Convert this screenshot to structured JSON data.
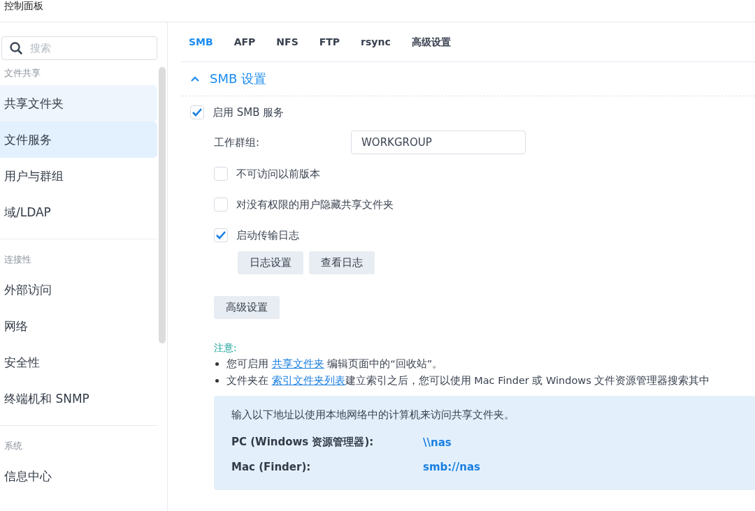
{
  "window": {
    "title": "控制面板"
  },
  "sidebar": {
    "search": {
      "placeholder": "搜索"
    },
    "sections": [
      {
        "title": "文件共享",
        "items": [
          {
            "label": "共享文件夹",
            "selected": false,
            "hovered": true
          },
          {
            "label": "文件服务",
            "selected": true,
            "hovered": false
          },
          {
            "label": "用户与群组",
            "selected": false,
            "hovered": false
          },
          {
            "label": "域/LDAP",
            "selected": false,
            "hovered": false
          }
        ]
      },
      {
        "title": "连接性",
        "items": [
          {
            "label": "外部访问",
            "selected": false,
            "hovered": false
          },
          {
            "label": "网络",
            "selected": false,
            "hovered": false
          },
          {
            "label": "安全性",
            "selected": false,
            "hovered": false
          },
          {
            "label": "终端机和 SNMP",
            "selected": false,
            "hovered": false
          }
        ]
      },
      {
        "title": "系统",
        "items": [
          {
            "label": "信息中心",
            "selected": false,
            "hovered": false
          }
        ]
      }
    ]
  },
  "tabs": [
    {
      "label": "SMB",
      "selected": true
    },
    {
      "label": "AFP",
      "selected": false
    },
    {
      "label": "NFS",
      "selected": false
    },
    {
      "label": "FTP",
      "selected": false
    },
    {
      "label": "rsync",
      "selected": false
    },
    {
      "label": "高级设置",
      "selected": false
    }
  ],
  "section": {
    "title": "SMB 设置",
    "expanded": true
  },
  "enable": {
    "label": "启用 SMB 服务",
    "checked": true
  },
  "workgroup": {
    "label": "工作群组:",
    "value": "WORKGROUP"
  },
  "options": [
    {
      "label": "不可访问以前版本",
      "checked": false
    },
    {
      "label": "对没有权限的用户隐藏共享文件夹",
      "checked": false
    },
    {
      "label": "启动传输日志",
      "checked": true
    }
  ],
  "log_buttons": [
    "日志设置",
    "查看日志"
  ],
  "advanced_button": "高级设置",
  "notes": {
    "title": "注意:",
    "items": [
      {
        "before": "您可启用 ",
        "link": "共享文件夹",
        "after": " 编辑页面中的“回收站”。"
      },
      {
        "before": "文件夹在 ",
        "link": "索引文件夹列表",
        "after": "建立索引之后，您可以使用 Mac Finder 或 Windows 文件资源管理器搜索其中"
      }
    ]
  },
  "access": {
    "intro": "输入以下地址以使用本地网络中的计算机来访问共享文件夹。",
    "rows": [
      {
        "label": "PC (Windows 资源管理器):",
        "value": "\\\\nas"
      },
      {
        "label": "Mac (Finder):",
        "value": "smb://nas"
      }
    ]
  }
}
